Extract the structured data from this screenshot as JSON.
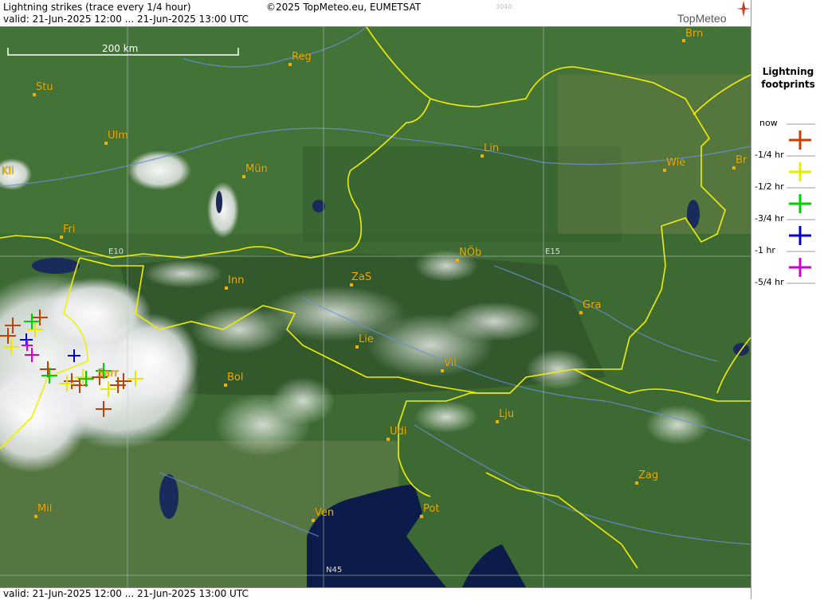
{
  "header": {
    "title": "Lightning strikes (trace every 1/4 hour)",
    "valid": "valid:  21-Jun-2025 12:00 ... 21-Jun-2025 13:00 UTC",
    "copyright": "©2025 TopMeteo.eu, EUMETSAT",
    "code": "3040",
    "logo": "TopMeteo"
  },
  "footer": {
    "valid": "valid:  21-Jun-2025 12:00 ... 21-Jun-2025 13:00 UTC"
  },
  "map": {
    "scale_label": "200 km",
    "grid_labels": {
      "e10": "E10",
      "e15": "E15",
      "n45": "N45"
    },
    "cities": [
      "Brn",
      "Reg",
      "Stu",
      "Ulm",
      "Kli",
      "Mün",
      "Lin",
      "Wie",
      "Br",
      "Fri",
      "NÖb",
      "ZaS",
      "Inn",
      "Gra",
      "Lie",
      "Vil",
      "Sarr",
      "Bol",
      "Lju",
      "Udi",
      "Zag",
      "Mil",
      "Ven",
      "Pot"
    ],
    "colors": {
      "border": "#f0f000",
      "city": "#f0b000",
      "land": "#3f6b35",
      "sea": "#0d1b4a"
    }
  },
  "legend": {
    "title_line1": "Lightning",
    "title_line2": "footprints",
    "items": [
      {
        "label": "now",
        "color": "#c84000"
      },
      {
        "label": "-1/4 hr",
        "color": "#e8e800"
      },
      {
        "label": "-1/2 hr",
        "color": "#00d000"
      },
      {
        "label": "-3/4 hr",
        "color": "#0000c8"
      },
      {
        "label": "-1 hr",
        "color": "#d000d0"
      },
      {
        "label": "-5/4 hr",
        "color": ""
      }
    ]
  }
}
